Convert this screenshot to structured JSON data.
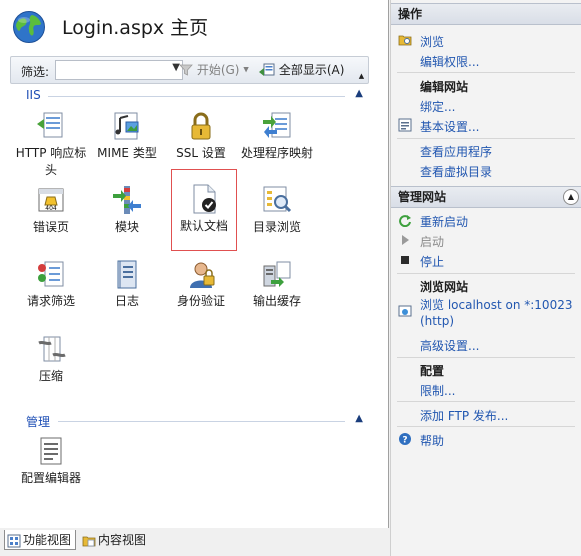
{
  "header": {
    "title": "Login.aspx 主页"
  },
  "filter": {
    "label": "筛选:",
    "value": "",
    "start_label": "开始(G)",
    "show_all_label": "全部显示(A)"
  },
  "groups": {
    "iis": "IIS",
    "management": "管理"
  },
  "features": {
    "http_headers": "HTTP 响应标头",
    "mime_types": "MIME 类型",
    "ssl": "SSL 设置",
    "handler_mappings": "处理程序映射",
    "error_pages": "错误页",
    "modules": "模块",
    "default_document": "默认文档",
    "directory_browsing": "目录浏览",
    "request_filtering": "请求筛选",
    "logging": "日志",
    "authentication": "身份验证",
    "output_caching": "输出缓存",
    "compression": "压缩",
    "config_editor": "配置编辑器"
  },
  "tabs": {
    "features_view": "功能视图",
    "content_view": "内容视图"
  },
  "actions": {
    "header": "操作",
    "explore": "浏览",
    "edit_permissions": "编辑权限...",
    "edit_site_title": "编辑网站",
    "bindings": "绑定...",
    "basic_settings": "基本设置...",
    "view_apps": "查看应用程序",
    "view_vdirs": "查看虚拟目录",
    "manage_site_header": "管理网站",
    "restart": "重新启动",
    "start": "启动",
    "stop": "停止",
    "browse_site_title": "浏览网站",
    "browse_line1": "浏览 localhost on *:10023",
    "browse_line2": "(http)",
    "advanced_settings": "高级设置...",
    "configure_title": "配置",
    "limits": "限制...",
    "add_ftp": "添加 FTP 发布...",
    "help": "帮助"
  },
  "colors": {
    "link": "#2257b0",
    "group_title": "#1f4fb5",
    "selection_outline": "#e05050"
  }
}
